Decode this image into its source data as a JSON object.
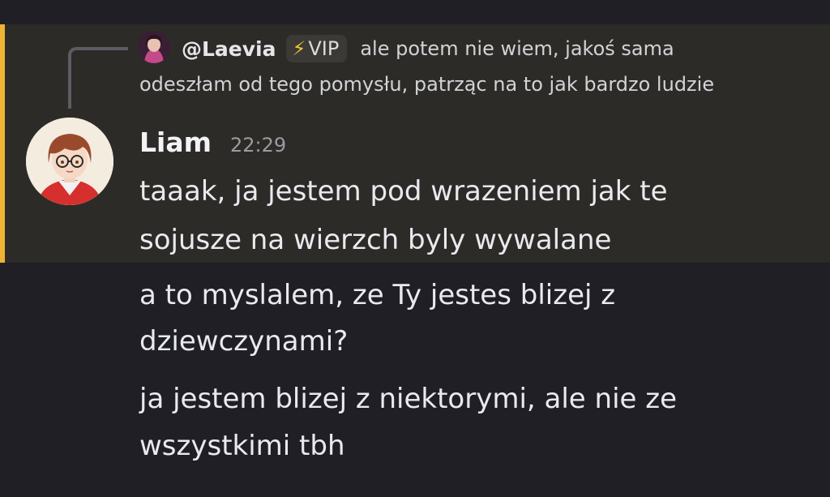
{
  "reply": {
    "author": "@Laevia",
    "badge_label": "VIP",
    "badge_icon": "lightning-icon",
    "text_line1": "ale potem nie wiem, jakoś sama",
    "text_line2": "odeszłam od tego pomysłu, patrząc na to jak bardzo ludzie"
  },
  "message": {
    "author": "Liam",
    "time": "22:29",
    "lines": [
      "taaak, ja jestem pod wrazeniem jak te",
      "sojusze na wierzch byly wywalane"
    ]
  },
  "followups": [
    {
      "lines": [
        "a to myslalem, ze Ty jestes blizej z",
        "dziewczynami?"
      ]
    },
    {
      "lines": [
        "ja jestem blizej z niektorymi, ale nie ze",
        "wszystkimi tbh"
      ]
    }
  ],
  "colors": {
    "background": "#1f1f25",
    "highlight_background": "#2d2b27",
    "mention_bar": "#f0b232",
    "badge_bolt": "#f7c338"
  }
}
